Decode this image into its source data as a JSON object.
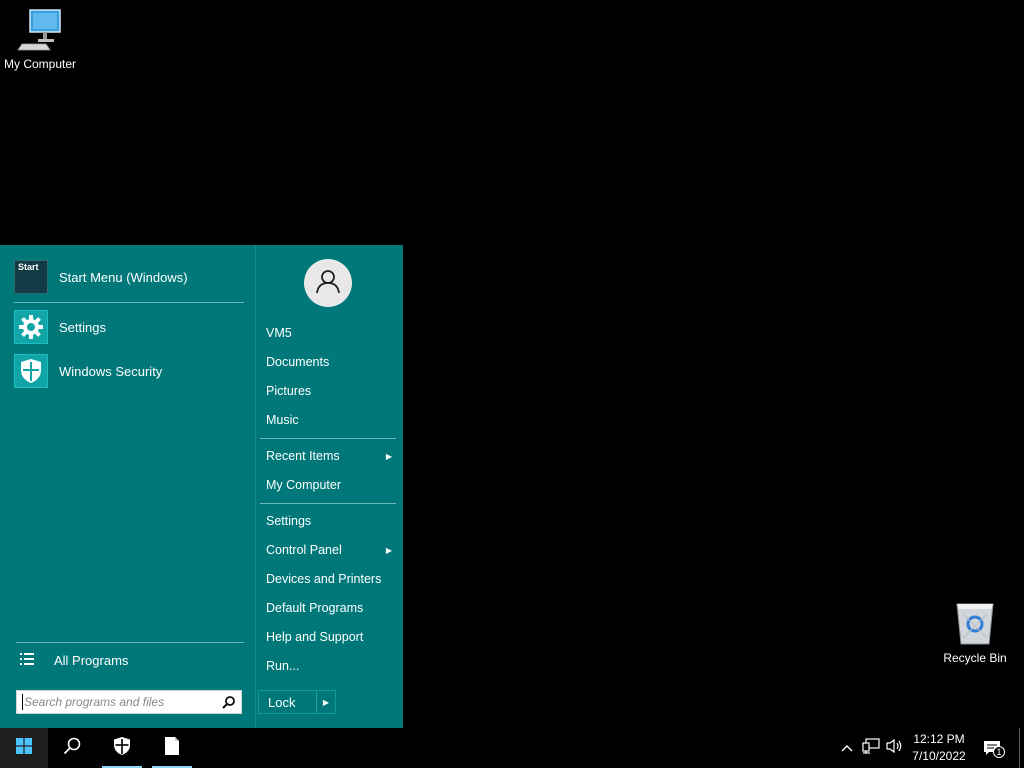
{
  "desktop": {
    "my_computer_label": "My Computer",
    "recycle_bin_label": "Recycle Bin"
  },
  "start_menu": {
    "pinned": [
      {
        "label": "Start Menu (Windows)",
        "icon": "start-menu-icon",
        "tile_text": "Start"
      },
      {
        "label": "Settings",
        "icon": "gear-icon"
      },
      {
        "label": "Windows Security",
        "icon": "shield-icon"
      }
    ],
    "all_programs_label": "All Programs",
    "search_placeholder": "Search programs and files",
    "right_items": [
      {
        "label": "VM5"
      },
      {
        "label": "Documents"
      },
      {
        "label": "Pictures"
      },
      {
        "label": "Music"
      },
      {
        "label": "Recent Items",
        "submenu": true
      },
      {
        "label": "My Computer"
      },
      {
        "label": "Settings"
      },
      {
        "label": "Control Panel",
        "submenu": true
      },
      {
        "label": "Devices and Printers"
      },
      {
        "label": "Default Programs"
      },
      {
        "label": "Help and Support"
      },
      {
        "label": "Run..."
      }
    ],
    "lock_label": "Lock"
  },
  "taskbar": {
    "clock_time": "12:12 PM",
    "clock_date": "7/10/2022",
    "notification_count": "1"
  },
  "colors": {
    "start_menu_bg": "#00787a",
    "tile_bg": "#12a5a8",
    "taskbar_bg": "#000000",
    "running_indicator": "#8fd7f7"
  }
}
